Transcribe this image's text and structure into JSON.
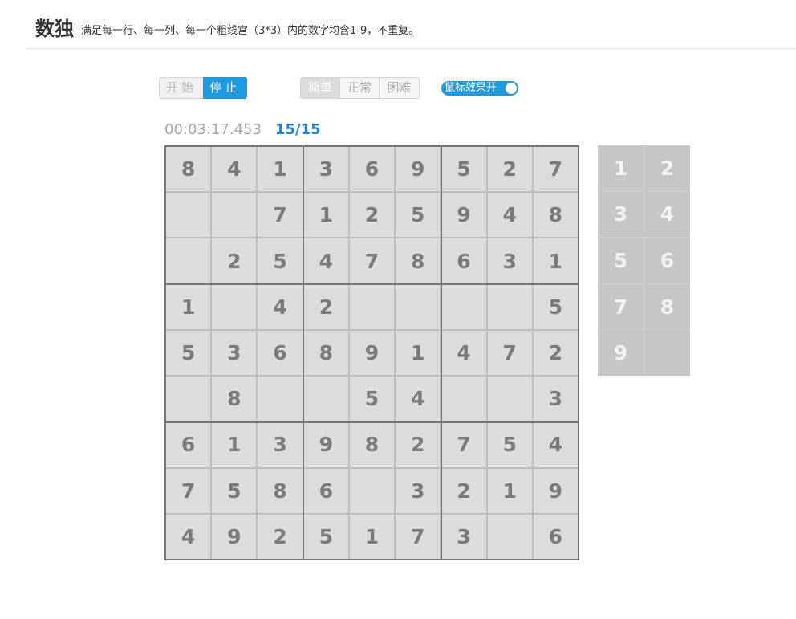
{
  "header": {
    "title": "数独",
    "subtitle": "满足每一行、每一列、每一个粗线宫（3*3）内的数字均含1-9，不重复。"
  },
  "controls": {
    "start_label": "开始",
    "stop_label": "停止",
    "difficulty": [
      "简单",
      "正常",
      "困难"
    ],
    "selected_difficulty": "简单",
    "mouse_effect_label": "鼠标效果开",
    "mouse_effect_on": true
  },
  "status": {
    "timer": "00:03:17.453",
    "progress": "15/15"
  },
  "board": [
    [
      "8",
      "4",
      "1",
      "3",
      "6",
      "9",
      "5",
      "2",
      "7"
    ],
    [
      "",
      "",
      "7",
      "1",
      "2",
      "5",
      "9",
      "4",
      "8"
    ],
    [
      "",
      "2",
      "5",
      "4",
      "7",
      "8",
      "6",
      "3",
      "1"
    ],
    [
      "1",
      "",
      "4",
      "2",
      "",
      "",
      "",
      "",
      "5"
    ],
    [
      "5",
      "3",
      "6",
      "8",
      "9",
      "1",
      "4",
      "7",
      "2"
    ],
    [
      "",
      "8",
      "",
      "",
      "5",
      "4",
      "",
      "",
      "3"
    ],
    [
      "6",
      "1",
      "3",
      "9",
      "8",
      "2",
      "7",
      "5",
      "4"
    ],
    [
      "7",
      "5",
      "8",
      "6",
      "",
      "3",
      "2",
      "1",
      "9"
    ],
    [
      "4",
      "9",
      "2",
      "5",
      "1",
      "7",
      "3",
      "",
      "6"
    ]
  ],
  "keypad": [
    "1",
    "2",
    "3",
    "4",
    "5",
    "6",
    "7",
    "8",
    "9",
    ""
  ],
  "colors": {
    "accent": "#1e9be0",
    "progress": "#1e87d2",
    "cell_bg": "#dcdcdc",
    "cell_text": "#7a7a7a",
    "keypad_bg": "#c6c6c4"
  }
}
